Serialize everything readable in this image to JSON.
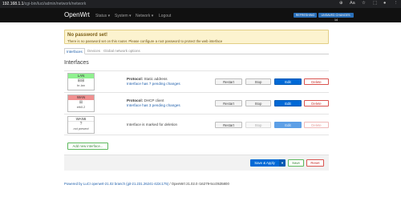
{
  "browser": {
    "url_host": "192.168.1.1",
    "url_path": "/cgi-bin/luci/admin/network/network",
    "icons": [
      "zoom-icon",
      "reader-icon",
      "star-icon",
      "extensions-icon",
      "profile-icon",
      "menu-icon"
    ]
  },
  "header": {
    "brand": "OpenWrt",
    "menu": [
      {
        "label": "Status ▾"
      },
      {
        "label": "System ▾"
      },
      {
        "label": "Network ▾"
      },
      {
        "label": "Logout"
      }
    ],
    "badges": [
      "REFRESHING",
      "UNSAVED CHANGES: 14"
    ]
  },
  "alert": {
    "title": "No password set!",
    "text": "There is no password set on this router. Please configure a root password to protect the web interface"
  },
  "tabs": [
    {
      "label": "Interfaces",
      "active": true
    },
    {
      "label": "Devices",
      "active": false
    },
    {
      "label": "Global network options",
      "active": false
    }
  ],
  "section_title": "Interfaces",
  "interfaces": [
    {
      "name": "LAN",
      "glyph": "⊞⊞",
      "device": "br-lan",
      "protocol_label": "Protocol:",
      "protocol": "Static address",
      "changes": "Interface has 7 pending changes",
      "buttons": {
        "restart": "Restart",
        "stop": "Stop",
        "edit": "Edit",
        "delete": "Delete"
      }
    },
    {
      "name": "WAN",
      "glyph": "⊞",
      "device": "eth0.2",
      "protocol_label": "Protocol:",
      "protocol": "DHCP client",
      "changes": "Interface has 3 pending changes",
      "buttons": {
        "restart": "Restart",
        "stop": "Stop",
        "edit": "Edit",
        "delete": "Delete"
      }
    },
    {
      "name": "WAN6",
      "glyph": "?",
      "device": "not present",
      "status": "Interface is marked for deletion",
      "buttons": {
        "restart": "Restart",
        "stop": "Stop",
        "edit": "Edit",
        "delete": "Delete"
      }
    }
  ],
  "add_button": "Add new interface...",
  "actions": {
    "save_apply": "Save & Apply",
    "dropdown": "▾",
    "save": "Save",
    "reset": "Reset"
  },
  "footer": {
    "powered_link": "Powered by LuCI openwrt-21.02 branch (git-21.231.26241-422c175)",
    "powered_rest": " / OpenWrt 21.02.0 r16279-5cc0535800"
  },
  "colors": {
    "lan": "#90f090",
    "wan": "#f09090",
    "primary": "#0069d6",
    "danger": "#d9534f",
    "success": "#5cb85c"
  }
}
